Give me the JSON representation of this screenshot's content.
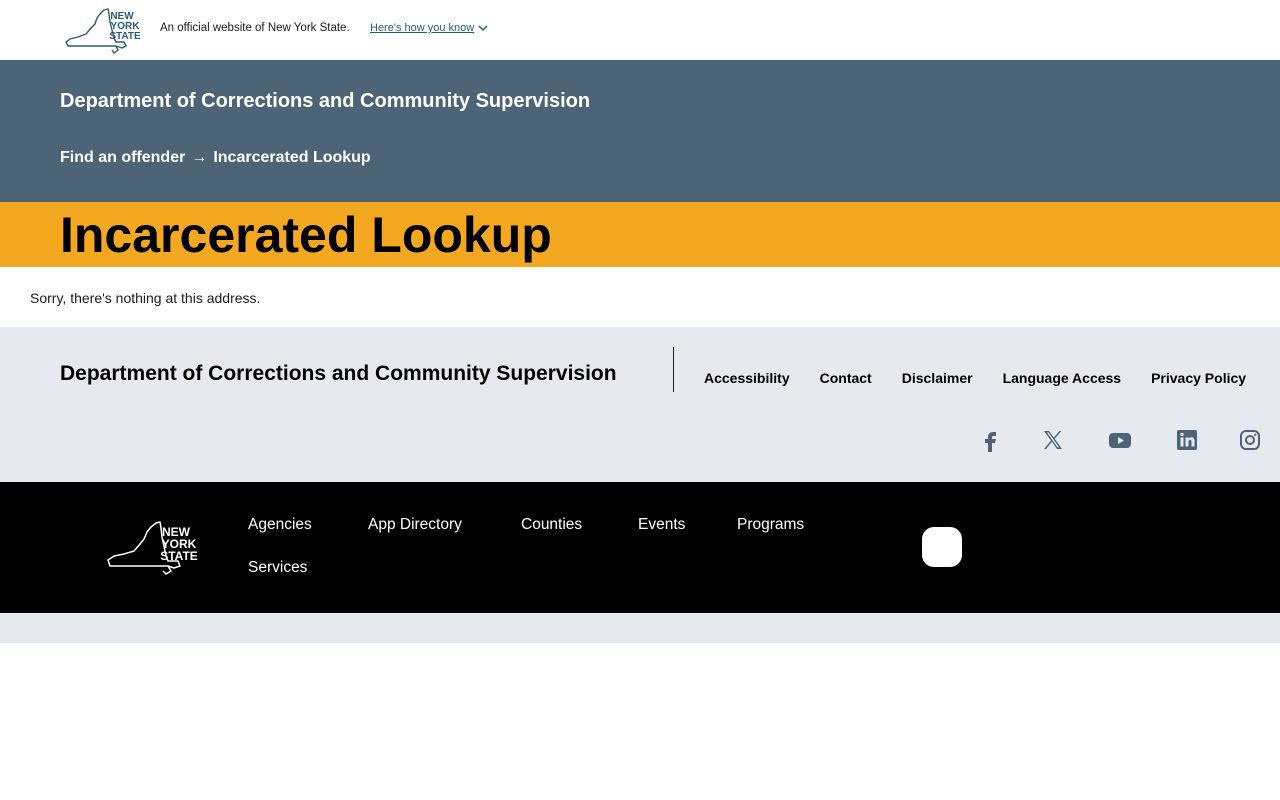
{
  "universal_header": {
    "logo_alt": "NEW YORK STATE",
    "logo_lines": [
      "NEW",
      "YORK",
      "STATE"
    ],
    "official_text": "An official website of New York State.",
    "how_you_know_link": "Here's how you know"
  },
  "agency_header": {
    "agency_name": "Department of Corrections and Community Supervision",
    "breadcrumb": {
      "parent": "Find an offender",
      "separator": "→",
      "current": "Incarcerated Lookup"
    }
  },
  "page": {
    "title": "Incarcerated Lookup",
    "message": "Sorry, there's nothing at this address."
  },
  "agency_footer": {
    "agency_name": "Department of Corrections and Community Supervision",
    "links": [
      "Accessibility",
      "Contact",
      "Disclaimer",
      "Language Access",
      "Privacy Policy"
    ],
    "social_icons": [
      "facebook-icon",
      "x-twitter-icon",
      "youtube-icon",
      "linkedin-icon",
      "instagram-icon"
    ]
  },
  "global_footer": {
    "logo_lines": [
      "NEW",
      "YORK",
      "STATE"
    ],
    "nav": [
      "Agencies",
      "App Directory",
      "Counties",
      "Events",
      "Programs",
      "Services"
    ]
  },
  "colors": {
    "agency_bar": "#4d6477",
    "title_bar": "#f3a81f",
    "footer_bg": "#e6eaef",
    "global_footer_bg": "#000000",
    "link_blue": "#1f5b8b"
  }
}
